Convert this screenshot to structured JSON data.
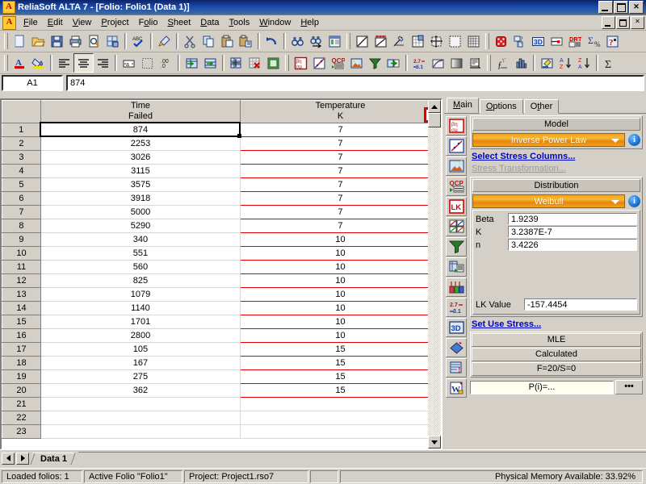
{
  "window": {
    "title": "ReliaSoft ALTA 7 - [Folio: Folio1 (Data 1)]",
    "app_icon": "A",
    "buttons": {
      "minimize": "_",
      "maximize": "□",
      "close": "✕"
    },
    "mdi_buttons": {
      "minimize": "_",
      "restore": "❐",
      "close": "✕"
    }
  },
  "menu": {
    "icon": "A",
    "items": [
      {
        "label": "File",
        "accel": "F"
      },
      {
        "label": "Edit",
        "accel": "E"
      },
      {
        "label": "View",
        "accel": "V"
      },
      {
        "label": "Project",
        "accel": "P"
      },
      {
        "label": "Folio",
        "accel": "o"
      },
      {
        "label": "Sheet",
        "accel": "S"
      },
      {
        "label": "Data",
        "accel": "D"
      },
      {
        "label": "Tools",
        "accel": "T"
      },
      {
        "label": "Window",
        "accel": "W"
      },
      {
        "label": "Help",
        "accel": "H"
      }
    ]
  },
  "toolbar1": [
    {
      "name": "new-document-icon",
      "tip": "New"
    },
    {
      "name": "open-folder-icon",
      "tip": "Open"
    },
    {
      "name": "save-icon",
      "tip": "Save"
    },
    {
      "name": "print-icon",
      "tip": "Print"
    },
    {
      "name": "print-preview-icon",
      "tip": "Print Preview"
    },
    {
      "name": "page-setup-icon",
      "tip": "Page Setup"
    },
    {
      "name": "spell-check-icon",
      "tip": "Spelling"
    },
    {
      "name": "format-painter-icon",
      "tip": "Format Painter"
    },
    {
      "name": "cut-scissors-icon",
      "tip": "Cut"
    },
    {
      "name": "copy-icon",
      "tip": "Copy"
    },
    {
      "name": "paste-icon",
      "tip": "Paste"
    },
    {
      "name": "paste-special-icon",
      "tip": "Paste Special"
    },
    {
      "name": "undo-icon",
      "tip": "Undo"
    },
    {
      "name": "find-binoculars-icon",
      "tip": "Find"
    },
    {
      "name": "find-next-icon",
      "tip": "Find Next"
    },
    {
      "name": "project-explorer-icon",
      "tip": "Project Explorer"
    },
    {
      "name": "plot-sheet-icon",
      "tip": "Plot"
    },
    {
      "name": "add-plot-icon",
      "tip": "Add Plot"
    },
    {
      "name": "edit-plot-icon",
      "tip": "Edit Plot"
    },
    {
      "name": "plot-grid-icon",
      "tip": "Plot Grid"
    },
    {
      "name": "move-plot-icon",
      "tip": "Move Plot"
    },
    {
      "name": "blank-plot-icon",
      "tip": "Blank Plot"
    },
    {
      "name": "grid-lines-icon",
      "tip": "Grid Lines"
    },
    {
      "name": "monte-carlo-dice-icon",
      "tip": "Monte Carlo"
    },
    {
      "name": "quick-stat-icon",
      "tip": "Quick Statistical"
    },
    {
      "name": "three-d-plot-icon",
      "tip": "3D Plot"
    },
    {
      "name": "degradation-icon",
      "tip": "Degradation"
    },
    {
      "name": "drt-icon",
      "tip": "DRT"
    },
    {
      "name": "sigma-percent-icon",
      "tip": "Statistics"
    },
    {
      "name": "help-question-icon",
      "tip": "Help"
    }
  ],
  "toolbar2": [
    {
      "name": "font-color-icon",
      "tip": "Font Color"
    },
    {
      "name": "fill-color-icon",
      "tip": "Fill Color"
    },
    {
      "name": "align-left-icon",
      "tip": "Align Left"
    },
    {
      "name": "align-center-icon",
      "tip": "Align Center",
      "pressed": true
    },
    {
      "name": "align-right-icon",
      "tip": "Align Right"
    },
    {
      "name": "merge-cells-icon",
      "tip": "Merge Cells"
    },
    {
      "name": "borders-icon",
      "tip": "Borders"
    },
    {
      "name": "decimal-icon",
      "tip": "Decimals"
    },
    {
      "name": "insert-column-icon",
      "tip": "Insert Column"
    },
    {
      "name": "insert-row-icon",
      "tip": "Insert Row"
    },
    {
      "name": "insert-cells-icon",
      "tip": "Insert Cells"
    },
    {
      "name": "delete-cells-icon",
      "tip": "Delete Cells"
    },
    {
      "name": "sheet-icon",
      "tip": "Sheet"
    },
    {
      "name": "beta-eta-icon",
      "tip": "Parameters"
    },
    {
      "name": "plot-line-icon",
      "tip": "Plot"
    },
    {
      "name": "qcp-icon",
      "tip": "Quick Calculation Pad"
    },
    {
      "name": "image-icon",
      "tip": "Picture"
    },
    {
      "name": "filter-funnel-icon",
      "tip": "Filter"
    },
    {
      "name": "transfer-data-icon",
      "tip": "Transfer Data"
    },
    {
      "name": "convert-units-icon",
      "tip": "Convert Units"
    },
    {
      "name": "batch-auto-icon",
      "tip": "Batch Auto Run"
    },
    {
      "name": "gradient-icon",
      "tip": "Gradient"
    },
    {
      "name": "report-icon",
      "tip": "Report"
    },
    {
      "name": "function-wizard-icon",
      "tip": "Function Wizard"
    },
    {
      "name": "histogram-icon",
      "tip": "Histogram"
    },
    {
      "name": "edit-note-icon",
      "tip": "Edit Note"
    },
    {
      "name": "sort-az-icon",
      "tip": "Sort Ascending"
    },
    {
      "name": "sort-za-icon",
      "tip": "Sort Descending"
    },
    {
      "name": "autosum-icon",
      "tip": "AutoSum"
    }
  ],
  "formula_bar": {
    "name_box": "A1",
    "value": "874"
  },
  "sheet": {
    "columns": [
      {
        "header_line1": "Time",
        "header_line2": "Failed",
        "checkbox": false
      },
      {
        "header_line1": "Temperature",
        "header_line2": "K",
        "checkbox": true,
        "checkmark": "✔",
        "stress": true
      }
    ],
    "rows": [
      {
        "n": "1",
        "time": "874",
        "temp": "7"
      },
      {
        "n": "2",
        "time": "2253",
        "temp": "7"
      },
      {
        "n": "3",
        "time": "3026",
        "temp": "7"
      },
      {
        "n": "4",
        "time": "3115",
        "temp": "7"
      },
      {
        "n": "5",
        "time": "3575",
        "temp": "7"
      },
      {
        "n": "6",
        "time": "3918",
        "temp": "7"
      },
      {
        "n": "7",
        "time": "5000",
        "temp": "7"
      },
      {
        "n": "8",
        "time": "5290",
        "temp": "7"
      },
      {
        "n": "9",
        "time": "340",
        "temp": "10"
      },
      {
        "n": "10",
        "time": "551",
        "temp": "10"
      },
      {
        "n": "11",
        "time": "560",
        "temp": "10"
      },
      {
        "n": "12",
        "time": "825",
        "temp": "10"
      },
      {
        "n": "13",
        "time": "1079",
        "temp": "10"
      },
      {
        "n": "14",
        "time": "1140",
        "temp": "10"
      },
      {
        "n": "15",
        "time": "1701",
        "temp": "10"
      },
      {
        "n": "16",
        "time": "2800",
        "temp": "10"
      },
      {
        "n": "17",
        "time": "105",
        "temp": "15"
      },
      {
        "n": "18",
        "time": "167",
        "temp": "15"
      },
      {
        "n": "19",
        "time": "275",
        "temp": "15"
      },
      {
        "n": "20",
        "time": "362",
        "temp": "15"
      },
      {
        "n": "21",
        "time": "",
        "temp": ""
      },
      {
        "n": "22",
        "time": "",
        "temp": ""
      },
      {
        "n": "23",
        "time": "",
        "temp": ""
      }
    ],
    "selected_cell": "A1"
  },
  "panel": {
    "tabs": [
      {
        "label": "Main",
        "accel": "M",
        "active": true
      },
      {
        "label": "Options",
        "accel": "O",
        "active": false
      },
      {
        "label": "Other",
        "accel": "t",
        "active": false
      }
    ],
    "strip_icons": [
      {
        "name": "beta-eta-parameters-icon"
      },
      {
        "name": "plot-line-icon"
      },
      {
        "name": "image-plot-icon"
      },
      {
        "name": "qcp-icon"
      },
      {
        "name": "lk-icon"
      },
      {
        "name": "multi-plot-icon"
      },
      {
        "name": "filter-funnel-icon"
      },
      {
        "name": "transfer-data-icon"
      },
      {
        "name": "ranking-icon"
      },
      {
        "name": "convert-units-icon"
      },
      {
        "name": "three-d-plot-icon"
      },
      {
        "name": "blue-diamond-icon"
      },
      {
        "name": "alerts-icon"
      },
      {
        "name": "word-export-icon"
      }
    ],
    "model": {
      "title": "Model",
      "value": "Inverse Power Law",
      "info": "i"
    },
    "links": {
      "select_stress_columns": "Select Stress Columns...",
      "stress_transformation": "Stress Transformation...",
      "set_use_stress": "Set Use Stress..."
    },
    "distribution": {
      "title": "Distribution",
      "value": "Weibull",
      "info": "i"
    },
    "parameters": [
      {
        "label": "Beta",
        "value": "1.9239"
      },
      {
        "label": "K",
        "value": "3.2387E-7"
      },
      {
        "label": "n",
        "value": "3.4226"
      }
    ],
    "lk": {
      "label": "LK Value",
      "value": "-157.4454"
    },
    "mle": {
      "method": "MLE",
      "status": "Calculated",
      "counts": "F=20/S=0"
    },
    "pi": {
      "field": "P(i)=...",
      "button": "•••"
    }
  },
  "sheet_tabs": {
    "prev": "◄",
    "next": "►",
    "tabs": [
      {
        "label": "Data 1",
        "active": true
      }
    ]
  },
  "statusbar": {
    "loaded_folios": "Loaded folios: 1",
    "active_folio": "Active Folio \"Folio1\"",
    "project": "Project: Project1.rso7",
    "extra": "",
    "memory": "Physical Memory Available: 33.92%"
  },
  "colors": {
    "title_bar": "#0a246a",
    "face": "#d4d0c8",
    "stress_red": "#e00000",
    "link_blue": "#0000cc",
    "combo_orange": "#f0a020"
  }
}
